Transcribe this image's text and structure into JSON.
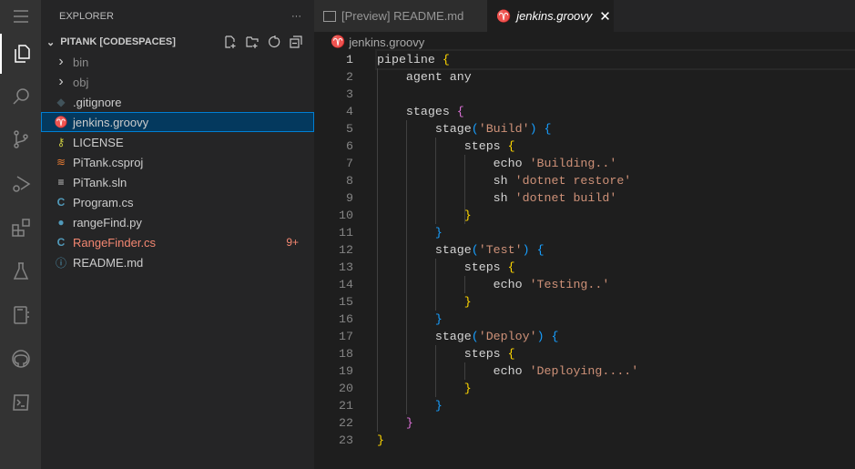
{
  "sidebar": {
    "title": "EXPLORER",
    "more": "···",
    "section": "PITANK [CODESPACES]",
    "files": [
      {
        "name": "bin",
        "kind": "folder",
        "icon": "chevron-right-icon"
      },
      {
        "name": "obj",
        "kind": "folder",
        "icon": "chevron-right-icon"
      },
      {
        "name": ".gitignore",
        "icon": "git-icon"
      },
      {
        "name": "jenkins.groovy",
        "icon": "jenkins-icon",
        "selected": true
      },
      {
        "name": "LICENSE",
        "icon": "license-icon"
      },
      {
        "name": "PiTank.csproj",
        "icon": "rss-icon"
      },
      {
        "name": "PiTank.sln",
        "icon": "lines-icon"
      },
      {
        "name": "Program.cs",
        "icon": "csharp-icon"
      },
      {
        "name": "rangeFind.py",
        "icon": "python-icon"
      },
      {
        "name": "RangeFinder.cs",
        "icon": "csharp-icon",
        "error": true,
        "badge": "9+"
      },
      {
        "name": "README.md",
        "icon": "info-icon"
      }
    ]
  },
  "tabs": [
    {
      "label": "[Preview] README.md"
    },
    {
      "label": "jenkins.groovy",
      "active": true,
      "close": "✕"
    }
  ],
  "breadcrumb": "jenkins.groovy",
  "colors": {
    "string": "#ce9178",
    "bracket1": "#ffd700",
    "bracket2": "#da70d6",
    "bracket3": "#179fff"
  },
  "code": [
    [
      [
        "pipeline ",
        ""
      ],
      [
        "{",
        "b1"
      ]
    ],
    [
      [
        "    agent any",
        ""
      ]
    ],
    [],
    [
      [
        "    stages ",
        ""
      ],
      [
        "{",
        "b2"
      ]
    ],
    [
      [
        "        stage",
        ""
      ],
      [
        "(",
        "b3"
      ],
      [
        "'Build'",
        "s"
      ],
      [
        ")",
        "b3"
      ],
      [
        " ",
        ""
      ],
      [
        "{",
        "b3"
      ]
    ],
    [
      [
        "            steps ",
        ""
      ],
      [
        "{",
        "b1"
      ]
    ],
    [
      [
        "                echo ",
        ""
      ],
      [
        "'Building..'",
        "s"
      ]
    ],
    [
      [
        "                sh ",
        ""
      ],
      [
        "'dotnet restore'",
        "s"
      ]
    ],
    [
      [
        "                sh ",
        ""
      ],
      [
        "'dotnet build'",
        "s"
      ]
    ],
    [
      [
        "            ",
        ""
      ],
      [
        "}",
        "b1"
      ]
    ],
    [
      [
        "        ",
        ""
      ],
      [
        "}",
        "b3"
      ]
    ],
    [
      [
        "        stage",
        ""
      ],
      [
        "(",
        "b3"
      ],
      [
        "'Test'",
        "s"
      ],
      [
        ")",
        "b3"
      ],
      [
        " ",
        ""
      ],
      [
        "{",
        "b3"
      ]
    ],
    [
      [
        "            steps ",
        ""
      ],
      [
        "{",
        "b1"
      ]
    ],
    [
      [
        "                echo ",
        ""
      ],
      [
        "'Testing..'",
        "s"
      ]
    ],
    [
      [
        "            ",
        ""
      ],
      [
        "}",
        "b1"
      ]
    ],
    [
      [
        "        ",
        ""
      ],
      [
        "}",
        "b3"
      ]
    ],
    [
      [
        "        stage",
        ""
      ],
      [
        "(",
        "b3"
      ],
      [
        "'Deploy'",
        "s"
      ],
      [
        ")",
        "b3"
      ],
      [
        " ",
        ""
      ],
      [
        "{",
        "b3"
      ]
    ],
    [
      [
        "            steps ",
        ""
      ],
      [
        "{",
        "b1"
      ]
    ],
    [
      [
        "                echo ",
        ""
      ],
      [
        "'Deploying....'",
        "s"
      ]
    ],
    [
      [
        "            ",
        ""
      ],
      [
        "}",
        "b1"
      ]
    ],
    [
      [
        "        ",
        ""
      ],
      [
        "}",
        "b3"
      ]
    ],
    [
      [
        "    ",
        ""
      ],
      [
        "}",
        "b2"
      ]
    ],
    [
      [
        "}",
        "b1"
      ]
    ]
  ]
}
